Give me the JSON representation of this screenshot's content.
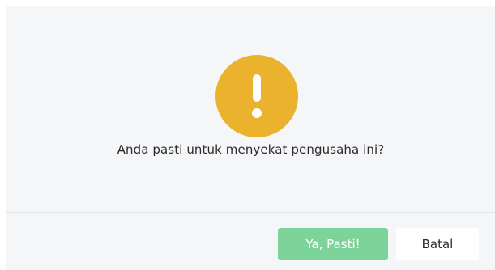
{
  "dialog": {
    "icon": "warning-exclamation-icon",
    "icon_color": "#ebb22e",
    "message": "Anda pasti untuk menyekat pengusaha ini?",
    "confirm_label": "Ya, Pasti!",
    "cancel_label": "Batal",
    "confirm_color": "#7dd49a"
  }
}
